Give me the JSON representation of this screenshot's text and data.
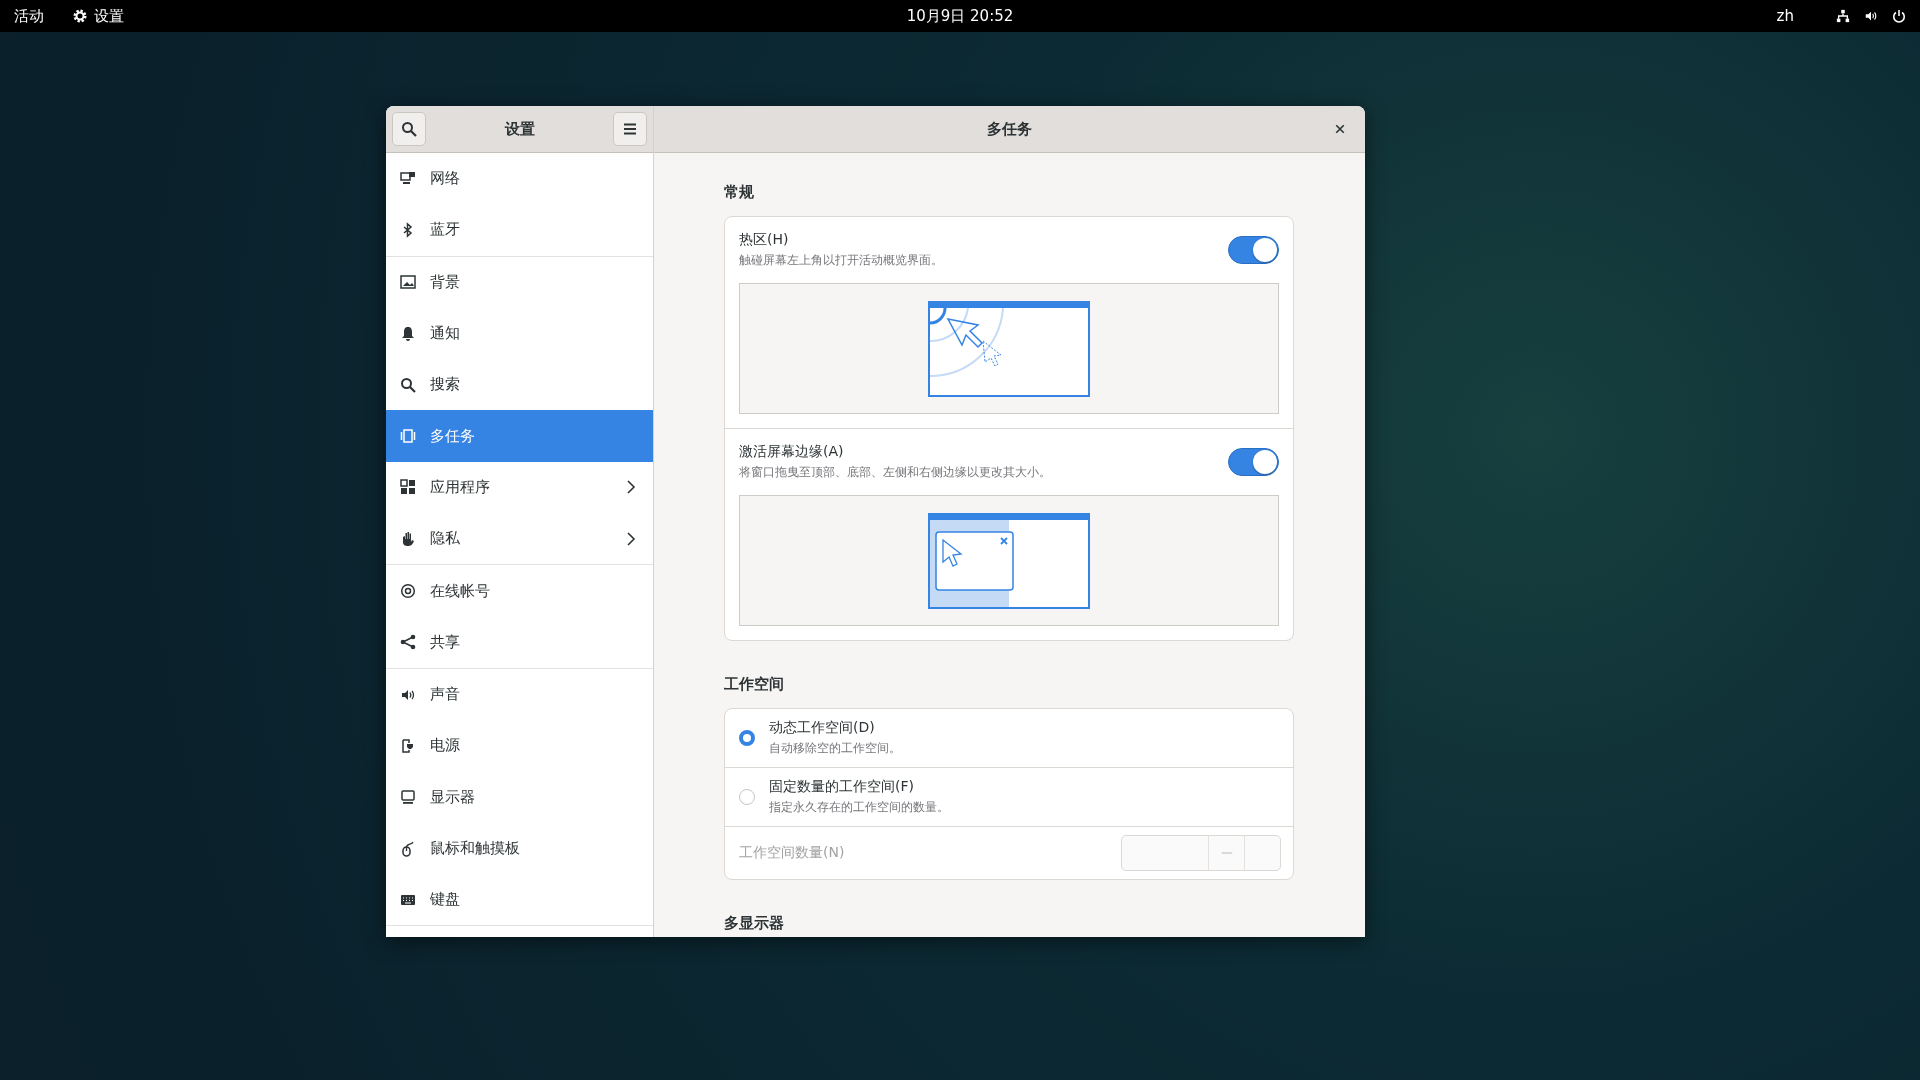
{
  "top_bar": {
    "activities": "活动",
    "app_menu": "设置",
    "clock": "10月9日  20:52",
    "input_method": "zh"
  },
  "sidebar": {
    "title": "设置",
    "sections": [
      {
        "items": [
          {
            "kind": "network",
            "label": "网络",
            "selected": false,
            "arrow": false
          },
          {
            "kind": "bluetooth",
            "label": "蓝牙",
            "selected": false,
            "arrow": false
          }
        ]
      },
      {
        "items": [
          {
            "kind": "background",
            "label": "背景",
            "selected": false,
            "arrow": false
          },
          {
            "kind": "bell",
            "label": "通知",
            "selected": false,
            "arrow": false
          },
          {
            "kind": "search",
            "label": "搜索",
            "selected": false,
            "arrow": false
          },
          {
            "kind": "multitask",
            "label": "多任务",
            "selected": true,
            "arrow": false
          },
          {
            "kind": "apps",
            "label": "应用程序",
            "selected": false,
            "arrow": true
          },
          {
            "kind": "hand",
            "label": "隐私",
            "selected": false,
            "arrow": true
          }
        ]
      },
      {
        "items": [
          {
            "kind": "at",
            "label": "在线帐号",
            "selected": false,
            "arrow": false
          },
          {
            "kind": "share",
            "label": "共享",
            "selected": false,
            "arrow": false
          }
        ]
      },
      {
        "items": [
          {
            "kind": "sound",
            "label": "声音",
            "selected": false,
            "arrow": false
          },
          {
            "kind": "power",
            "label": "电源",
            "selected": false,
            "arrow": false
          },
          {
            "kind": "display",
            "label": "显示器",
            "selected": false,
            "arrow": false
          },
          {
            "kind": "mouse",
            "label": "鼠标和触摸板",
            "selected": false,
            "arrow": false
          },
          {
            "kind": "keyboard",
            "label": "键盘",
            "selected": false,
            "arrow": false
          }
        ]
      }
    ]
  },
  "page": {
    "title": "多任务",
    "sections": [
      {
        "kind": "switches",
        "title": "常规",
        "rows": [
          {
            "title": "热区(H)",
            "subtitle": "触碰屏幕左上角以打开活动概览界面。",
            "on": true,
            "kind": "hot-corner"
          },
          {
            "title": "激活屏幕边缘(A)",
            "subtitle": "将窗口拖曳至顶部、底部、左侧和右侧边缘以更改其大小。",
            "on": true,
            "kind": "edge"
          }
        ]
      },
      {
        "kind": "radios",
        "title": "工作空间",
        "rows": [
          {
            "title": "动态工作空间(D)",
            "subtitle": "自动移除空的工作空间。",
            "selected": true
          },
          {
            "title": "固定数量的工作空间(F)",
            "subtitle": "指定永久存在的工作空间的数量。",
            "selected": false
          }
        ],
        "spin": {
          "label": "工作空间数量(N)",
          "disabled": true
        }
      },
      {
        "kind": "heading",
        "title": "多显示器"
      }
    ]
  }
}
